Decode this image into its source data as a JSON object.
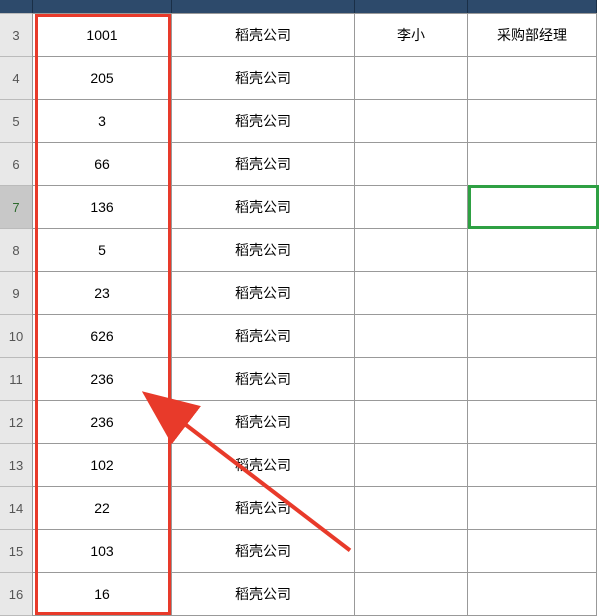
{
  "row_headers": [
    "3",
    "4",
    "5",
    "6",
    "7",
    "8",
    "9",
    "10",
    "11",
    "12",
    "13",
    "14",
    "15",
    "16"
  ],
  "selected_row_index": 4,
  "col_a_values": [
    "1001",
    "205",
    "3",
    "66",
    "136",
    "5",
    "23",
    "626",
    "236",
    "236",
    "102",
    "22",
    "103",
    "16"
  ],
  "col_b_values": [
    "稻壳公司",
    "稻壳公司",
    "稻壳公司",
    "稻壳公司",
    "稻壳公司",
    "稻壳公司",
    "稻壳公司",
    "稻壳公司",
    "稻壳公司",
    "稻壳公司",
    "稻壳公司",
    "稻壳公司",
    "稻壳公司",
    "稻壳公司"
  ],
  "col_c_values": [
    "李小",
    "",
    "",
    "",
    "",
    "",
    "",
    "",
    "",
    "",
    "",
    "",
    "",
    ""
  ],
  "col_d_values": [
    "采购部经理",
    "",
    "",
    "",
    "",
    "",
    "",
    "",
    "",
    "",
    "",
    "",
    "",
    ""
  ],
  "highlights": {
    "red_col_a": true,
    "green_cell": {
      "row_index": 4,
      "col": "d"
    },
    "arrow_target_row_index": 9
  }
}
